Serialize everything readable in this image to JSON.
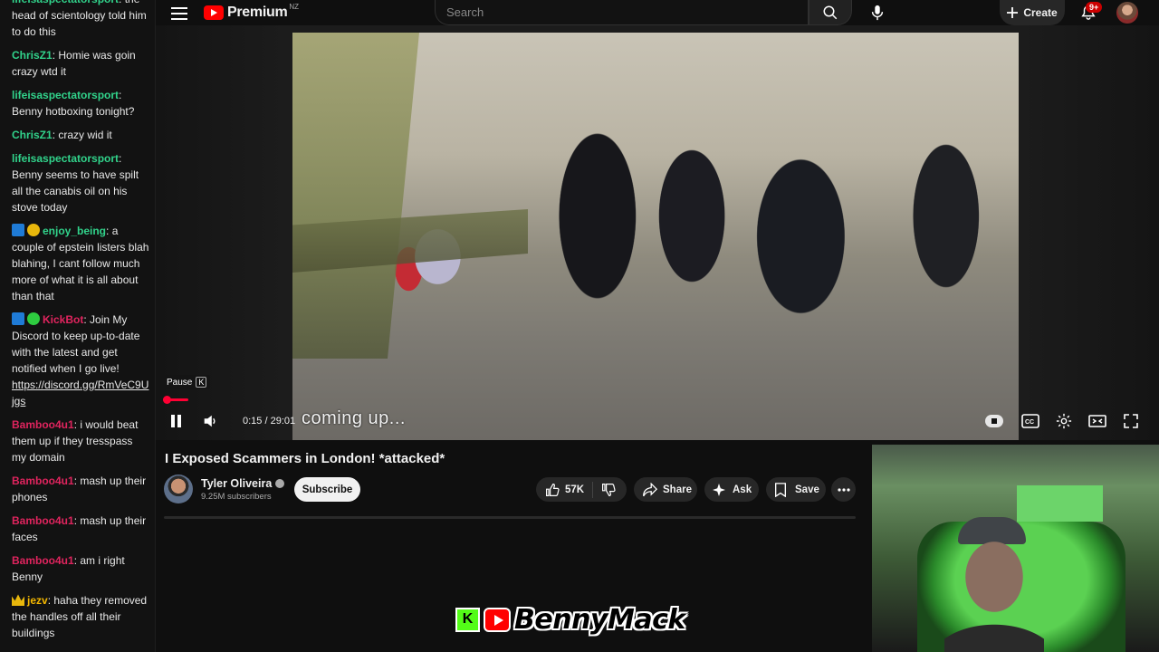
{
  "chat": {
    "messages": [
      {
        "user": "lifeisaspectatorsport",
        "color": "#31d38b",
        "badges": [],
        "text": "the head of scientology told him to do this"
      },
      {
        "user": "ChrisZ1",
        "color": "#31d38b",
        "badges": [],
        "text": "Homie was goin crazy wtd it"
      },
      {
        "user": "lifeisaspectatorsport",
        "color": "#31d38b",
        "badges": [],
        "text": "Benny hotboxing tonight?"
      },
      {
        "user": "ChrisZ1",
        "color": "#31d38b",
        "badges": [],
        "text": "crazy wid it"
      },
      {
        "user": "lifeisaspectatorsport",
        "color": "#31d38b",
        "badges": [],
        "text": "Benny seems to have spilt all the canabis oil on his stove today"
      },
      {
        "user": "enjoy_being",
        "color": "#31d38b",
        "badges": [
          "blue",
          "gold"
        ],
        "text": "a couple of epstein listers blah blahing, I cant follow much more of what it is all about than that"
      },
      {
        "user": "KickBot",
        "color": "#e0245e",
        "badges": [
          "blue",
          "green"
        ],
        "text": "Join My Discord to keep up-to-date with the latest and get notified when I go live!",
        "link": "https://discord.gg/RmVeC9Ujgs"
      },
      {
        "user": "Bamboo4u1",
        "color": "#e0245e",
        "badges": [],
        "text": "i would beat them up if they tresspass my domain"
      },
      {
        "user": "Bamboo4u1",
        "color": "#e0245e",
        "badges": [],
        "text": "mash up their phones"
      },
      {
        "user": "Bamboo4u1",
        "color": "#e0245e",
        "badges": [],
        "text": "mash up their faces"
      },
      {
        "user": "Bamboo4u1",
        "color": "#e0245e",
        "badges": [],
        "text": "am i right Benny"
      },
      {
        "user": "jezv",
        "color": "#f5b800",
        "badges": [
          "crown"
        ],
        "text": "haha they removed the handles off all their buildings"
      }
    ]
  },
  "masthead": {
    "logo_text": "Premium",
    "region": "NZ",
    "search_placeholder": "Search",
    "create_label": "Create",
    "notification_count": "9+"
  },
  "player": {
    "caption": "coming up...",
    "tooltip_label": "Pause",
    "tooltip_key": "K",
    "current_time": "0:15",
    "duration": "29:01",
    "progress_fraction": 0.0086
  },
  "video": {
    "title": "I Exposed Scammers in London! *attacked*",
    "channel_name": "Tyler Oliveira",
    "subscribers": "9.25M subscribers",
    "subscribe_label": "Subscribe",
    "like_count": "57K",
    "share_label": "Share",
    "ask_label": "Ask",
    "save_label": "Save"
  },
  "brand": {
    "k_letter": "K",
    "name": "BennyMack"
  }
}
